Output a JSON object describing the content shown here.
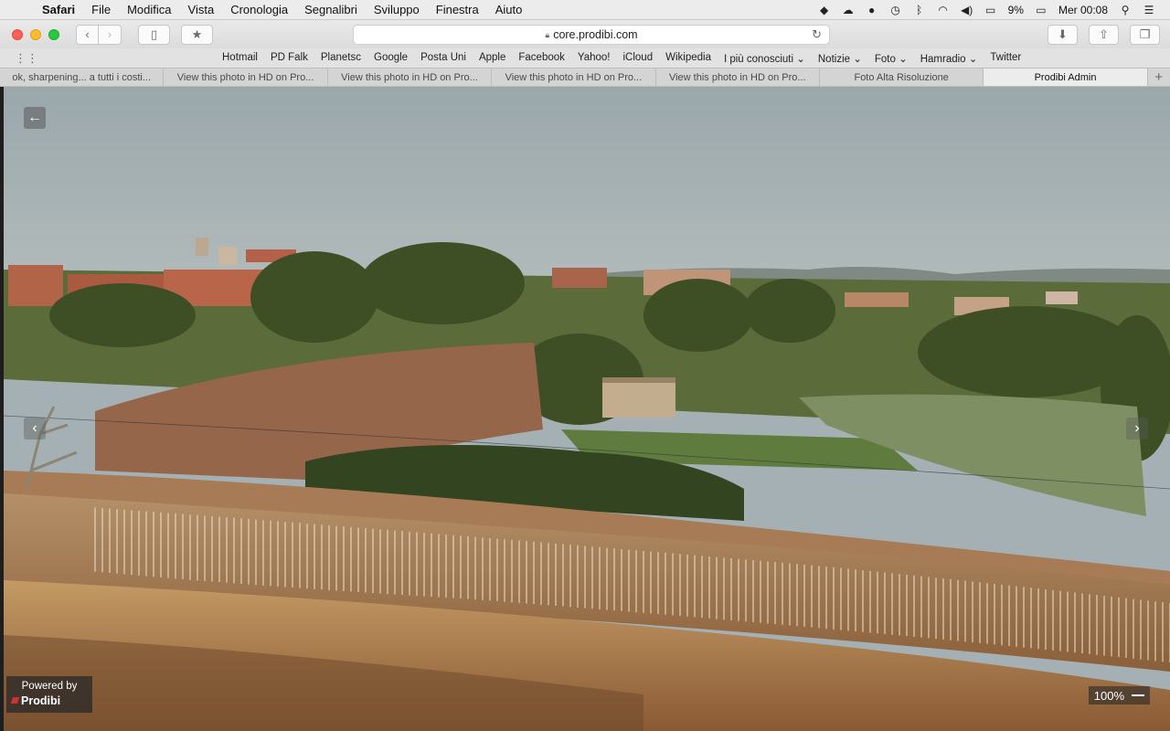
{
  "menubar": {
    "app_name": "Safari",
    "menus": [
      "File",
      "Modifica",
      "Vista",
      "Cronologia",
      "Segnalibri",
      "Sviluppo",
      "Finestra",
      "Aiuto"
    ],
    "battery": "9%",
    "clock": "Mer 00:08"
  },
  "toolbar": {
    "url": "core.prodibi.com"
  },
  "favorites": [
    "Hotmail",
    "PD Falk",
    "Planetsc",
    "Google",
    "Posta Uni",
    "Apple",
    "Facebook",
    "Yahoo!",
    "iCloud",
    "Wikipedia",
    "I più conosciuti ⌄",
    "Notizie ⌄",
    "Foto ⌄",
    "Hamradio ⌄",
    "Twitter"
  ],
  "tabs": [
    {
      "label": "ok, sharpening... a tutti i costi..."
    },
    {
      "label": "View this photo in HD on Pro..."
    },
    {
      "label": "View this photo in HD on Pro..."
    },
    {
      "label": "View this photo in HD on Pro..."
    },
    {
      "label": "View this photo in HD on Pro..."
    },
    {
      "label": "Foto Alta Risoluzione"
    },
    {
      "label": "Prodibi Admin"
    }
  ],
  "viewer": {
    "powered_by": "Powered by",
    "brand": "Prodibi",
    "zoom_level": "100%"
  }
}
